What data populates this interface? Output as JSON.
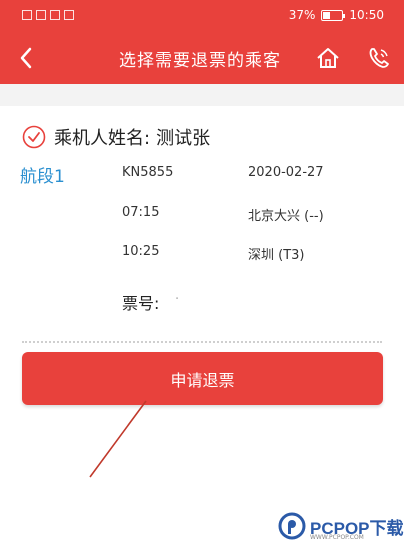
{
  "status_bar": {
    "battery": "37%",
    "battery_level": 0.37,
    "time": "10:50"
  },
  "nav": {
    "title": "选择需要退票的乘客",
    "back_icon": "chevron-left-icon",
    "home_icon": "home-icon",
    "phone_icon": "phone-icon"
  },
  "passenger": {
    "label": "乘机人姓名:",
    "name": "测试张",
    "selected": true
  },
  "segment": {
    "label": "航段1",
    "flight_no": "KN5855",
    "date": "2020-02-27",
    "dep_time": "07:15",
    "dep_airport": "北京大兴 (--)",
    "arr_time": "10:25",
    "arr_airport": "深圳 (T3)"
  },
  "ticket": {
    "label": "票号:",
    "value": "·"
  },
  "refund_button": "申请退票",
  "watermark": {
    "logo_text": "PCPOP下载",
    "sub_text": "WWW.PCPOP.COM"
  },
  "colors": {
    "accent": "#e8413c",
    "segment_blue": "#2a8fd0",
    "watermark_blue": "#2b5aa8"
  }
}
